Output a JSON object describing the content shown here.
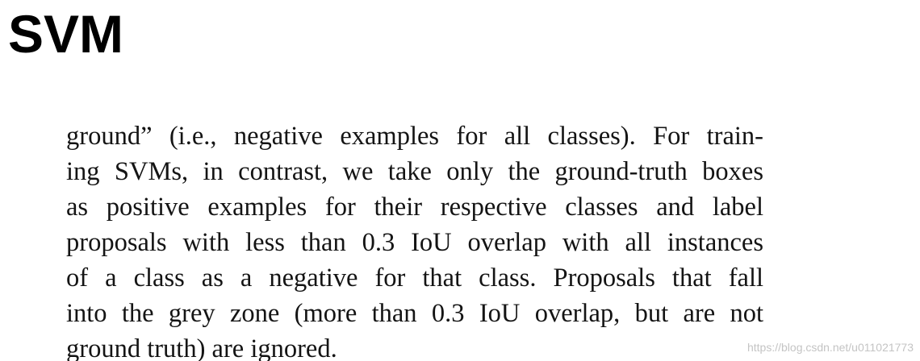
{
  "page": {
    "title": "SVM",
    "excerpt_lines": [
      "ground” (i.e., negative examples for all classes). For train-",
      "ing SVMs, in contrast, we take only the ground-truth boxes",
      "as positive examples for their respective classes and label",
      "proposals with less than 0.3 IoU overlap with all instances",
      "of a class as a negative for that class.  Proposals that fall",
      "into the grey zone (more than 0.3 IoU overlap, but are not",
      "ground truth) are ignored."
    ],
    "watermark": "https://blog.csdn.net/u011021773"
  }
}
